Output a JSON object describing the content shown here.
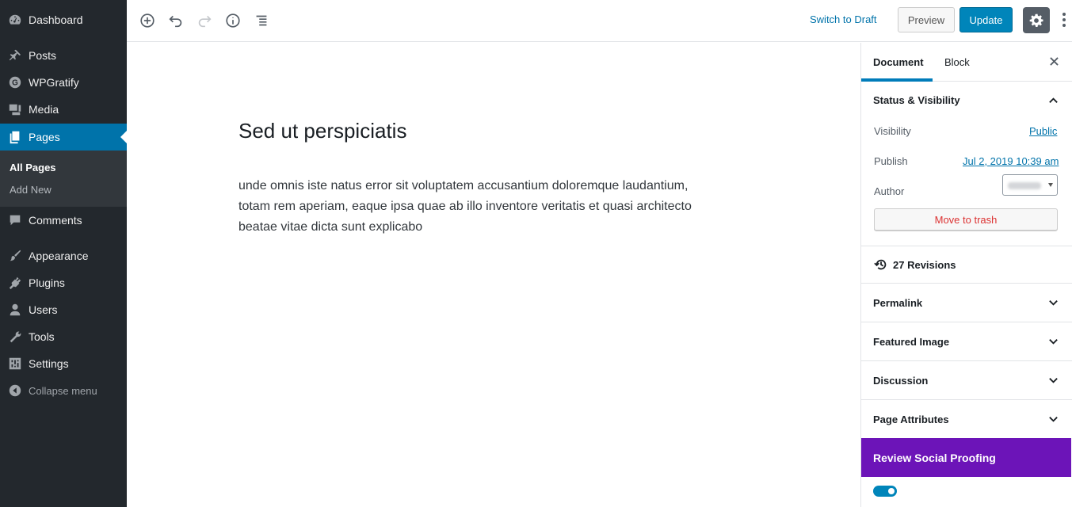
{
  "admin_menu": {
    "items": [
      {
        "label": "Dashboard",
        "icon": "dashboard-icon"
      },
      {
        "label": "Posts",
        "icon": "pin-icon"
      },
      {
        "label": "WPGratify",
        "icon": "wpgratify-icon"
      },
      {
        "label": "Media",
        "icon": "media-icon"
      },
      {
        "label": "Pages",
        "icon": "pages-icon"
      },
      {
        "label": "Comments",
        "icon": "comments-icon"
      },
      {
        "label": "Appearance",
        "icon": "brush-icon"
      },
      {
        "label": "Plugins",
        "icon": "plug-icon"
      },
      {
        "label": "Users",
        "icon": "user-icon"
      },
      {
        "label": "Tools",
        "icon": "wrench-icon"
      },
      {
        "label": "Settings",
        "icon": "settings-sliders-icon"
      }
    ],
    "submenu": [
      "All Pages",
      "Add New"
    ],
    "collapse_label": "Collapse menu"
  },
  "toolbar": {
    "switch_to_draft": "Switch to Draft",
    "preview": "Preview",
    "update": "Update"
  },
  "editor": {
    "title": "Sed ut perspiciatis",
    "content": "unde omnis iste natus error sit voluptatem accusantium doloremque laudantium, totam rem aperiam, eaque ipsa quae ab illo inventore veritatis et quasi architecto beatae vitae dicta sunt explicabo"
  },
  "sidebar": {
    "tabs": [
      "Document",
      "Block"
    ],
    "status_panel": {
      "title": "Status & Visibility",
      "visibility_label": "Visibility",
      "visibility_value": "Public",
      "publish_label": "Publish",
      "publish_value": "Jul 2, 2019 10:39 am",
      "author_label": "Author",
      "trash_label": "Move to trash"
    },
    "revisions": "27 Revisions",
    "panels": [
      "Permalink",
      "Featured Image",
      "Discussion",
      "Page Attributes"
    ],
    "social_title": "Review Social Proofing",
    "accent_color": "#6c14b8"
  }
}
